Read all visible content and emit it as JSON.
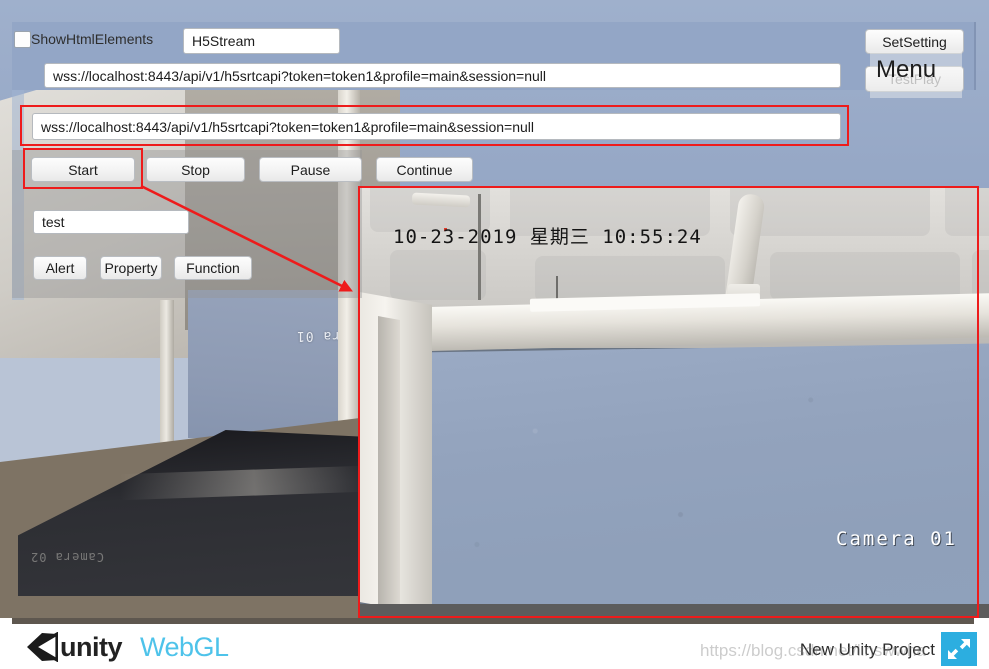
{
  "app": {
    "checkbox_label": "ShowHtmlElements",
    "checkbox_checked": false,
    "title_field_value": "H5Stream"
  },
  "fields": {
    "url_primary": "wss://localhost:8443/api/v1/h5srtcapi?token=token1&profile=main&session=null",
    "url_secondary": "wss://localhost:8443/api/v1/h5srtcapi?token=token1&profile=main&session=null",
    "test_value": "test"
  },
  "top_buttons": {
    "set_setting": "SetSetting",
    "test_play": "TestPlay",
    "menu_overlay": "Menu"
  },
  "playback_buttons": [
    {
      "label": "Start"
    },
    {
      "label": "Stop"
    },
    {
      "label": "Pause"
    },
    {
      "label": "Continue"
    }
  ],
  "action_buttons": [
    {
      "label": "Alert"
    },
    {
      "label": "Property"
    },
    {
      "label": "Function"
    }
  ],
  "video": {
    "timestamp": "10-23-2019 星期三 10:55:24",
    "camera_label": "Camera 01",
    "reflected_camera_label": "Camera 01",
    "reflected_dark_label": "Camera 02"
  },
  "footer": {
    "logo_unity": "unity",
    "logo_webgl": "WebGL",
    "project_name": "New Unity Project",
    "fullscreen_icon": "fullscreen-arrow-icon"
  },
  "watermark": {
    "text": "https://blog.csdn.net/linswwha"
  },
  "colors": {
    "panel_blue": "#93a6c6",
    "annotation_red": "#ee1b1b",
    "webgl_cyan": "#4ec3ea",
    "fullscreen_blue": "#2caee0",
    "footer_bar": "#5e574f"
  }
}
